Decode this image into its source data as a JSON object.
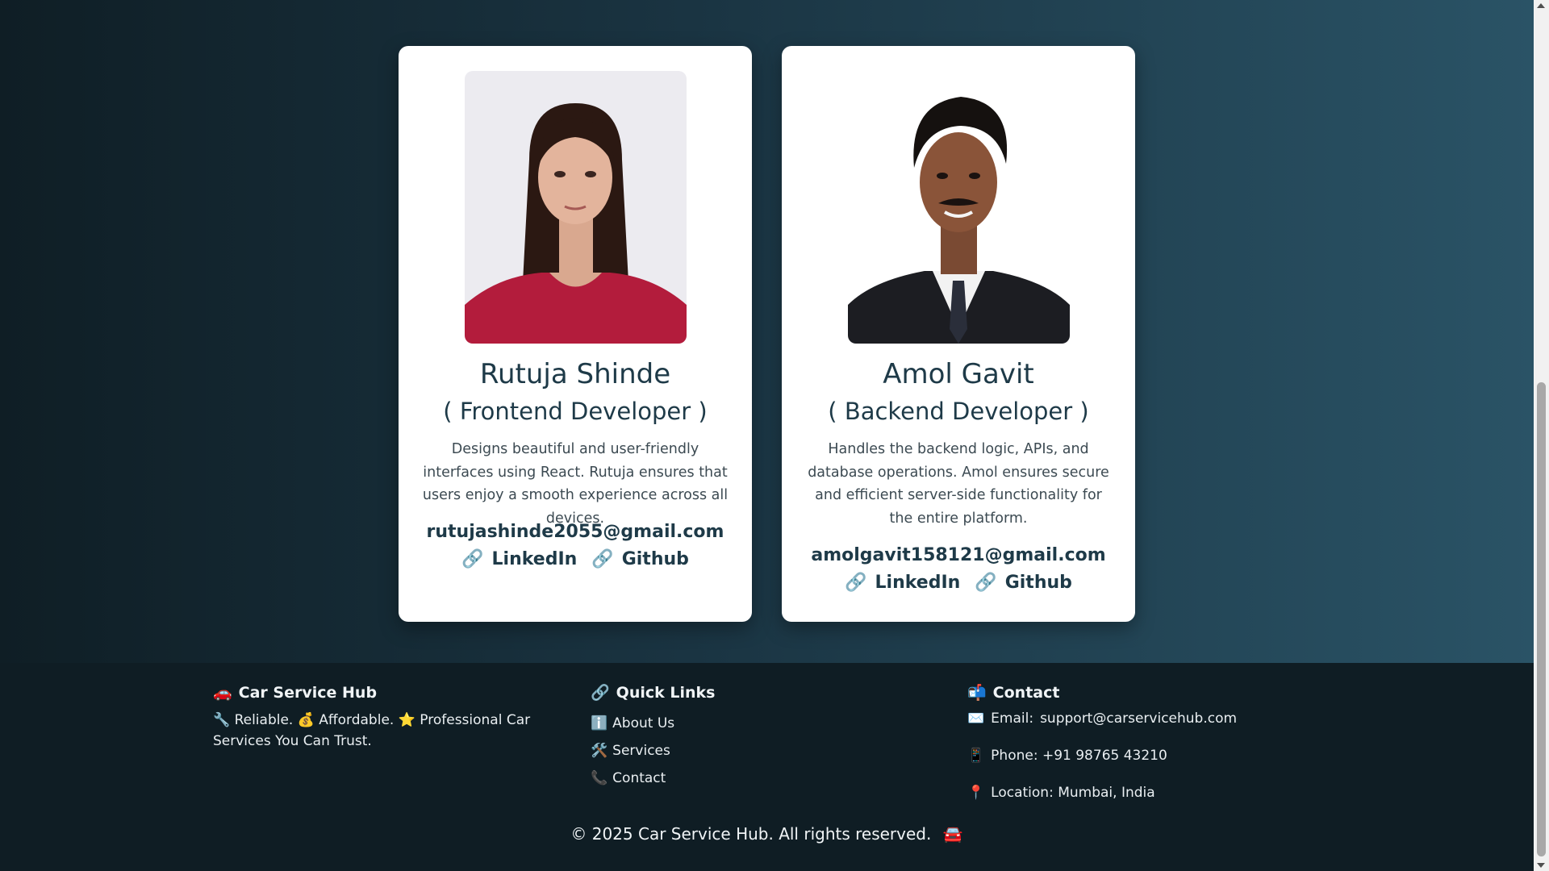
{
  "team": [
    {
      "name": "Rutuja Shinde",
      "role": "( Frontend Developer )",
      "description": "Designs beautiful and user-friendly interfaces using React. Rutuja ensures that users enjoy a smooth experience across all devices.",
      "email": "rutujashinde2055@gmail.com",
      "linkedin": "LinkedIn",
      "github": "Github"
    },
    {
      "name": "Amol Gavit",
      "role": "( Backend Developer )",
      "description": "Handles the backend logic, APIs, and database operations. Amol ensures secure and efficient server-side functionality for the entire platform.",
      "email": "amolgavit158121@gmail.com",
      "linkedin": "LinkedIn",
      "github": "Github"
    }
  ],
  "footer": {
    "brand": {
      "icon": "🚗",
      "title": "Car Service Hub",
      "tagline": "🔧 Reliable. 💰 Affordable. ⭐ Professional Car Services You Can Trust."
    },
    "quick_links": {
      "icon": "🔗",
      "title": "Quick Links",
      "items": [
        {
          "icon": "ℹ️",
          "label": "About Us"
        },
        {
          "icon": "🛠️",
          "label": "Services"
        },
        {
          "icon": "📞",
          "label": "Contact"
        }
      ]
    },
    "contact": {
      "icon": "📬",
      "title": "Contact",
      "email_icon": "✉️",
      "email_label": "Email:",
      "email": "support@carservicehub.com",
      "phone_icon": "📱",
      "phone": "Phone: +91 98765 43210",
      "location_icon": "📍",
      "location": "Location: Mumbai, India"
    },
    "copyright": "© 2025 Car Service Hub. All rights reserved.",
    "copyright_icon": "🚘"
  },
  "colors": {
    "accent": "#1e3a48",
    "footer_bg": "#0f1d24",
    "card_bg": "#ffffff"
  }
}
